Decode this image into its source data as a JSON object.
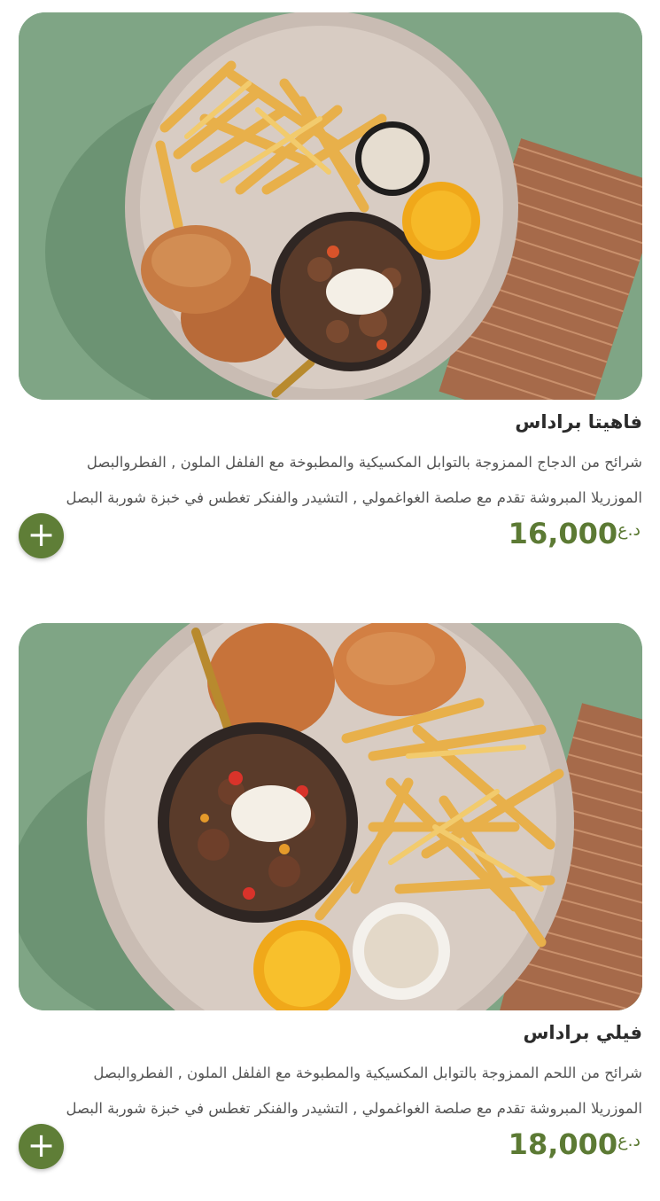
{
  "items": [
    {
      "name": "فاهيتا براداس",
      "description_lines": [
        "شرائح من الدجاج الممزوجة بالتوابل المكسيكية والمطبوخة مع الفلفل الملون , الفطروالبصل",
        "الموزريلا المبروشة تقدم مع صلصة الغواغمولي , التشيدر والفنكر تغطس في خبزة شوربة البصل"
      ],
      "price": "16,000",
      "currency": "د.ع",
      "add_label": "+",
      "image_icon": "fajita-chicken-plate-photo"
    },
    {
      "name": "فيلي براداس",
      "description_lines": [
        "شرائح من اللحم الممزوجة بالتوابل المكسيكية والمطبوخة مع الفلفل الملون , الفطروالبصل",
        "الموزريلا المبروشة تقدم مع صلصة الغواغمولي , التشيدر والفنكر تغطس في خبزة شوربة البصل"
      ],
      "price": "18,000",
      "currency": "د.ع",
      "add_label": "+",
      "image_icon": "philly-beef-plate-photo"
    }
  ],
  "colors": {
    "accent": "#5f7e37",
    "price": "#5c7a34",
    "photo_background": "#7fa585"
  }
}
